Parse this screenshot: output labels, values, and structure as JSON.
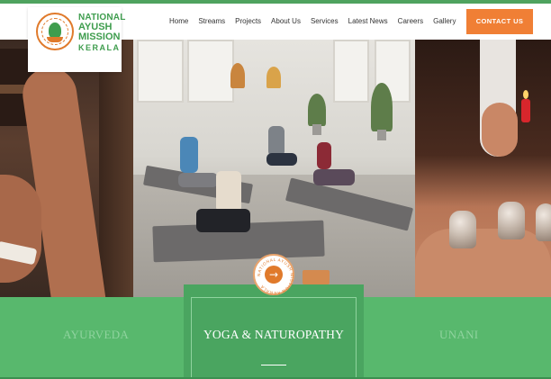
{
  "brand": {
    "name_line1": "NATIONAL",
    "name_line2": "AYUSH",
    "name_line3": "MISSION",
    "name_line4": "KERALA",
    "emblem_ring_text": "NATIONAL AYUSH MISSION",
    "primary_color": "#4fa35f",
    "accent_color": "#f07f35"
  },
  "nav": {
    "items": [
      "Home",
      "Streams",
      "Projects",
      "About Us",
      "Services",
      "Latest News",
      "Careers",
      "Gallery"
    ],
    "cta_label": "CONTACT US"
  },
  "hero": {
    "panels": [
      {
        "name": "ayurveda-therapy-image",
        "icon": "therapy-photo"
      },
      {
        "name": "yoga-class-image",
        "icon": "yoga-photo"
      },
      {
        "name": "cupping-therapy-image",
        "icon": "cupping-photo"
      }
    ]
  },
  "streams": {
    "left_label": "AYURVEDA",
    "active_label": "YOGA & NATUROPATHY",
    "right_label": "UNANI",
    "badge_text": "NATIONAL AYUSH MISSION KERALA",
    "badge_icon": "arrow-right-icon"
  }
}
